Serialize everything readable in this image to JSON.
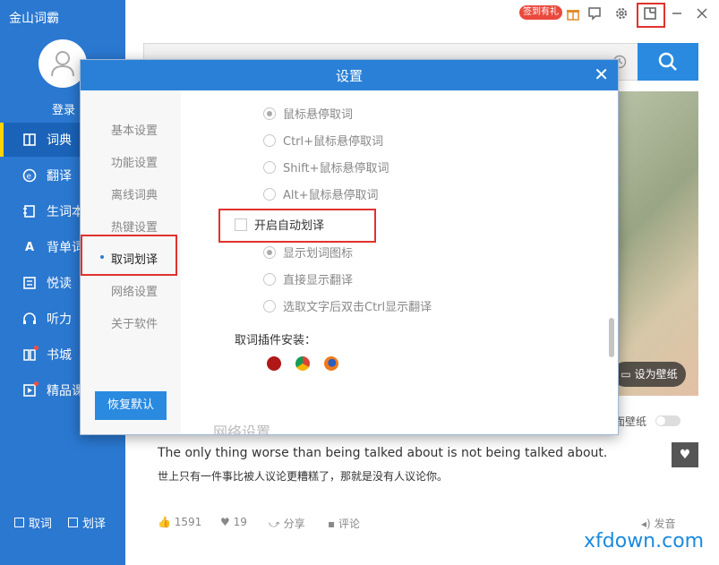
{
  "app": {
    "title": "金山词霸"
  },
  "user": {
    "login_label": "登录"
  },
  "sidebar": {
    "items": [
      {
        "label": "词典",
        "icon": "book-icon"
      },
      {
        "label": "翻译",
        "icon": "translate-icon"
      },
      {
        "label": "生词本",
        "icon": "notebook-icon"
      },
      {
        "label": "背单词",
        "icon": "memorize-icon"
      },
      {
        "label": "悦读",
        "icon": "reading-icon"
      },
      {
        "label": "听力",
        "icon": "headphones-icon"
      },
      {
        "label": "书城",
        "icon": "bookstore-icon"
      },
      {
        "label": "精品课",
        "icon": "course-icon"
      }
    ],
    "bottom": {
      "quci": "取词",
      "huayi": "划译"
    }
  },
  "topbar": {
    "signin_badge": "签到有礼"
  },
  "main": {
    "wallpaper_button": "设为壁纸",
    "desktop_wallpaper": "面壁纸",
    "quote_en": "The only thing worse than being talked about is not being talked about.",
    "quote_cn": "世上只有一件事比被人议论更糟糕了，那就是没有人议论你。",
    "stats": {
      "views": "1591",
      "likes": "19",
      "share": "分享",
      "comment": "评论",
      "speak": "发音"
    }
  },
  "dialog": {
    "title": "设置",
    "close": "✕",
    "menu": [
      "基本设置",
      "功能设置",
      "离线词典",
      "热键设置",
      "取词划译",
      "网络设置",
      "关于软件"
    ],
    "active_menu": "取词划译",
    "restore_button": "恢复默认",
    "options_hover": [
      {
        "label": "鼠标悬停取词",
        "checked": true
      },
      {
        "label": "Ctrl+鼠标悬停取词",
        "checked": false
      },
      {
        "label": "Shift+鼠标悬停取词",
        "checked": false
      },
      {
        "label": "Alt+鼠标悬停取词",
        "checked": false
      }
    ],
    "auto_translate": {
      "label": "开启自动划译",
      "checked": false
    },
    "options_translate": [
      {
        "label": "显示划词图标",
        "checked": true
      },
      {
        "label": "直接显示翻译",
        "checked": false
      },
      {
        "label": "选取文字后双击Ctrl显示翻译",
        "checked": false
      }
    ],
    "plugin_label": "取词插件安装：",
    "plugins": [
      "adobe-reader-icon",
      "chrome-icon",
      "firefox-icon"
    ],
    "next_section": "网络设置"
  },
  "watermark": "xfdown.com",
  "colors": {
    "accent": "#2a80d6",
    "sidebar": "#2a78d0",
    "highlight": "#e0322d"
  }
}
